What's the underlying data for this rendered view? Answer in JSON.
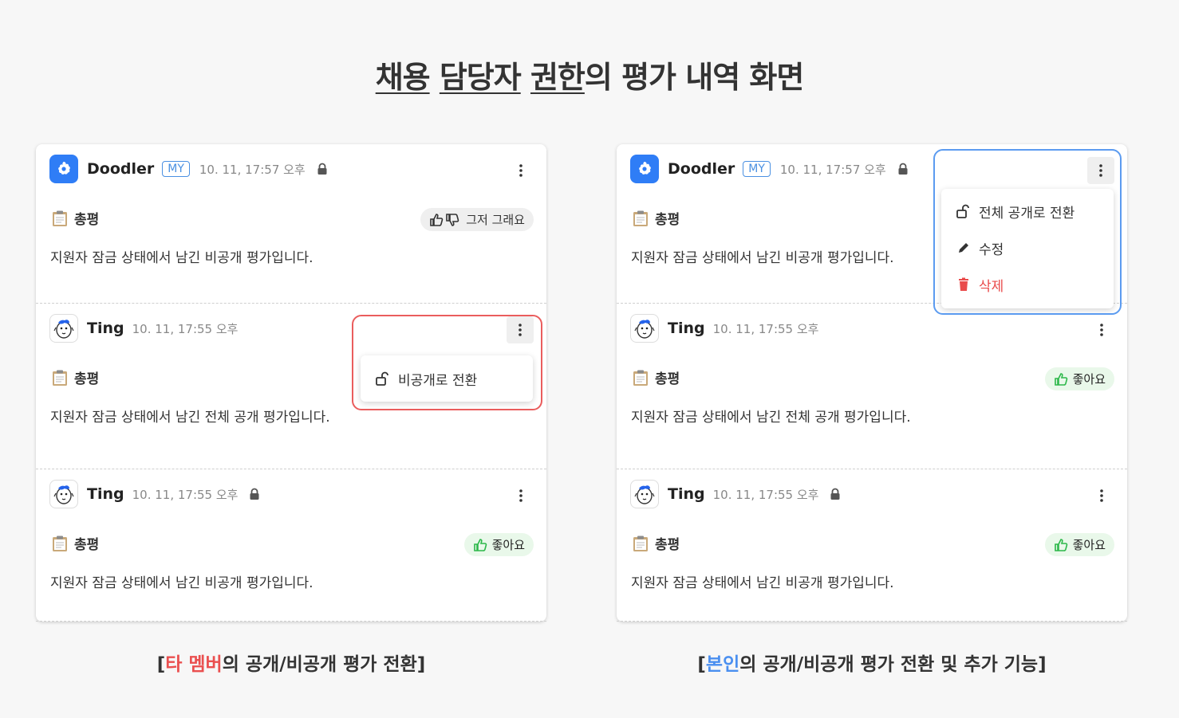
{
  "title": {
    "parts": [
      "채용 담당자 권한",
      "의 평가 내역 화면"
    ],
    "underlined_words": [
      "채용",
      "담당자",
      "권한"
    ]
  },
  "colors": {
    "primary_blue": "#2f7df6",
    "highlight_red": "#ea5d5d",
    "highlight_blue": "#5b9bf0",
    "danger": "#e94b4b"
  },
  "panels": {
    "left": {
      "cards": [
        {
          "user": "Doodler",
          "badge": "MY",
          "time": "10. 11, 17:57 오후",
          "private": true,
          "section": "총평",
          "rating": "그저 그래요",
          "rating_type": "neutral",
          "comment": "지원자 잠금 상태에서 남긴 비공개 평가입니다."
        },
        {
          "user": "Ting",
          "badge": "",
          "time": "10. 11, 17:55 오후",
          "private": false,
          "section": "총평",
          "rating": "",
          "rating_type": "",
          "comment": "지원자 잠금 상태에서 남긴 전체 공개 평가입니다."
        },
        {
          "user": "Ting",
          "badge": "",
          "time": "10. 11, 17:55 오후",
          "private": true,
          "section": "총평",
          "rating": "좋아요",
          "rating_type": "good",
          "comment": "지원자 잠금 상태에서 남긴 비공개 평가입니다."
        }
      ],
      "menu": {
        "items": [
          {
            "label": "비공개로 전환",
            "icon": "unlock-icon"
          }
        ]
      },
      "caption": {
        "open": "[",
        "highlight": "타 멤버",
        "rest": "의 공개/비공개 평가 전환]"
      }
    },
    "right": {
      "cards": [
        {
          "user": "Doodler",
          "badge": "MY",
          "time": "10. 11, 17:57 오후",
          "private": true,
          "section": "총평",
          "rating": "",
          "rating_type": "",
          "comment": "지원자 잠금 상태에서 남긴 비공개 평가입니다."
        },
        {
          "user": "Ting",
          "badge": "",
          "time": "10. 11, 17:55 오후",
          "private": false,
          "section": "총평",
          "rating": "좋아요",
          "rating_type": "good",
          "comment": "지원자 잠금 상태에서 남긴 전체 공개 평가입니다."
        },
        {
          "user": "Ting",
          "badge": "",
          "time": "10. 11, 17:55 오후",
          "private": true,
          "section": "총평",
          "rating": "좋아요",
          "rating_type": "good",
          "comment": "지원자 잠금 상태에서 남긴 비공개 평가입니다."
        }
      ],
      "menu": {
        "items": [
          {
            "label": "전체 공개로 전환",
            "icon": "unlock-icon"
          },
          {
            "label": "수정",
            "icon": "pencil-icon"
          },
          {
            "label": "삭제",
            "icon": "trash-icon"
          }
        ]
      },
      "caption": {
        "open": "[",
        "highlight": "본인",
        "rest": "의 공개/비공개 평가 전환 및 추가 기능]"
      }
    }
  }
}
